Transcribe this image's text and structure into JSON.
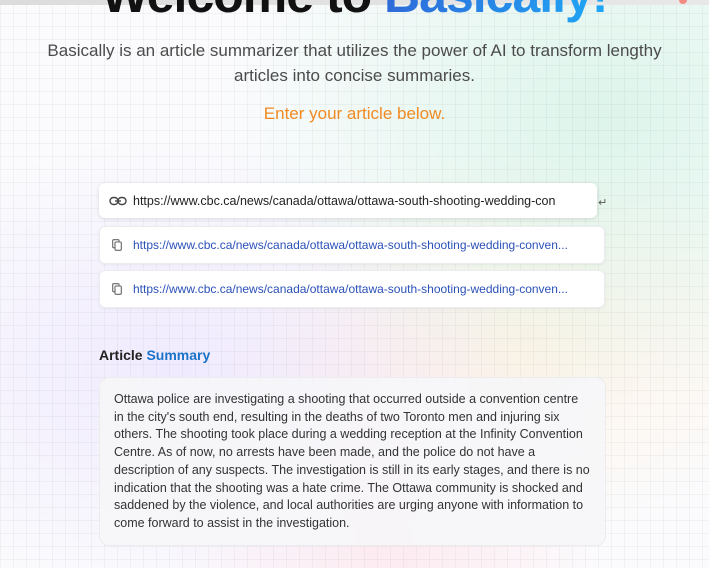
{
  "header": {
    "title_part1": "Welcome to",
    "title_part2": "Basically!",
    "description": "Basically is an article summarizer that utilizes the power of AI to transform lengthy articles into concise summaries.",
    "cta": "Enter your article below."
  },
  "url_input": {
    "value": "https://www.cbc.ca/news/canada/ottawa/ottawa-south-shooting-wedding-convention-centre",
    "link_icon": "link-icon",
    "submit_icon": "enter-icon",
    "submit_glyph": "↵"
  },
  "history": [
    {
      "url": "https://www.cbc.ca/news/canada/ottawa/ottawa-south-shooting-wedding-conven...",
      "icon": "copy-icon"
    },
    {
      "url": "https://www.cbc.ca/news/canada/ottawa/ottawa-south-shooting-wedding-conven...",
      "icon": "copy-icon"
    }
  ],
  "summary": {
    "heading_prefix": "Article",
    "heading_accent": "Summary",
    "text": "Ottawa police are investigating a shooting that occurred outside a convention centre in the city's south end, resulting in the deaths of two Toronto men and injuring six others. The shooting took place during a wedding reception at the Infinity Convention Centre. As of now, no arrests have been made, and the police do not have a description of any suspects. The investigation is still in its early stages, and there is no indication that the shooting was a hate crime. The Ottawa community is shocked and saddened by the violence, and local authorities are urging anyone with information to come forward to assist in the investigation."
  },
  "colors": {
    "accent_blue": "#1a73c8",
    "cta_orange": "#f08a22",
    "link_blue": "#2b51b8"
  }
}
